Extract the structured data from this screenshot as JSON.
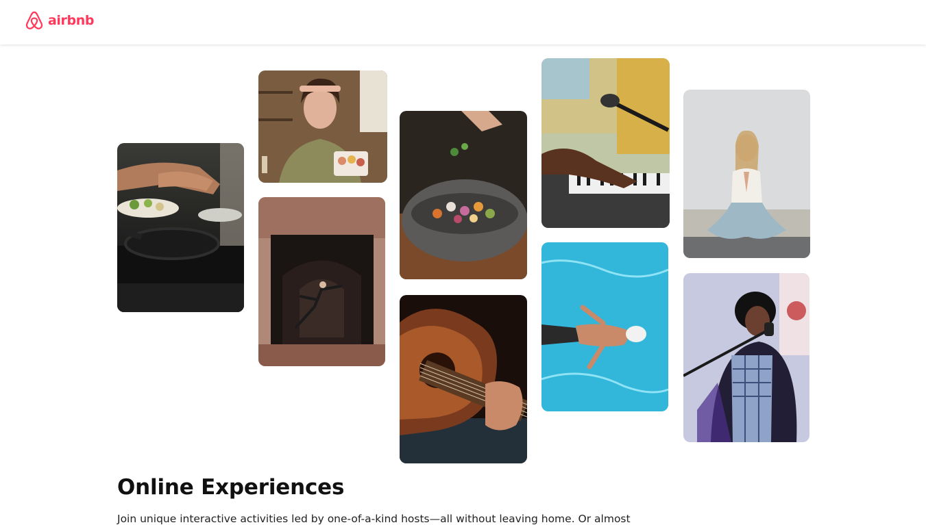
{
  "brand": {
    "name": "airbnb",
    "color": "#FF385C",
    "logo_icon": "airbnb-belo-icon"
  },
  "hero": {
    "images": [
      "cooking-class-photo",
      "baking-host-photo",
      "dancer-archway-photo",
      "food-bowl-photo",
      "guitar-photo",
      "keyboard-microphone-photo",
      "swimmer-photo",
      "yoga-photo",
      "singer-photo"
    ]
  },
  "content": {
    "title": "Online Experiences",
    "subtitle": "Join unique interactive activities led by one-of-a-kind hosts—all without leaving home. Or almost"
  }
}
